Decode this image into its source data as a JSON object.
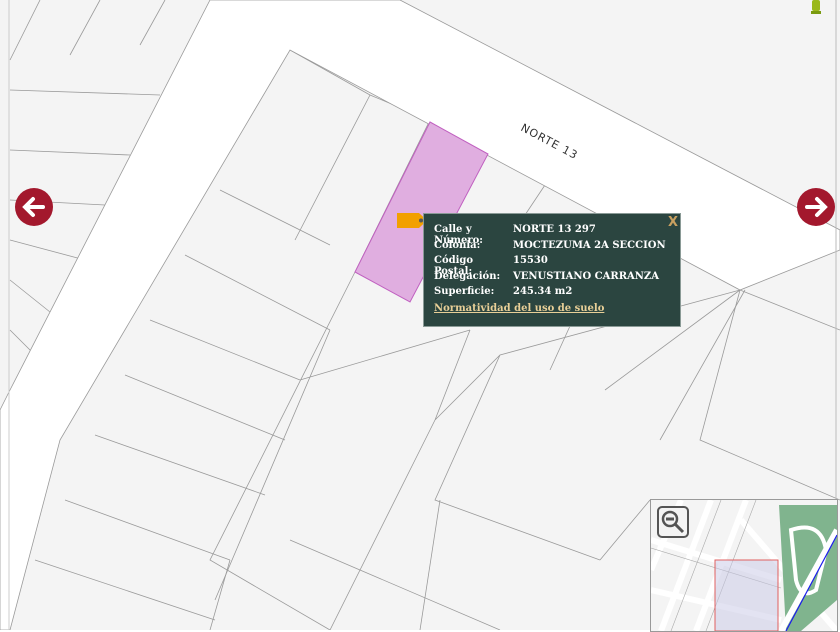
{
  "map": {
    "street_label": "NORTE 13",
    "parcel_highlight_color": "#e0aee0",
    "background": "#f4f4f4"
  },
  "nav": {
    "prev_icon": "arrow-left-icon",
    "next_icon": "arrow-right-icon",
    "color": "#a3182d"
  },
  "popup": {
    "close_label": "X",
    "rows": [
      {
        "label": "Calle y Número:",
        "value": "NORTE 13 297"
      },
      {
        "label": "Colonia:",
        "value": "MOCTEZUMA 2A SECCION"
      },
      {
        "label": "Código Postal:",
        "value": "15530"
      },
      {
        "label": "Delegación:",
        "value": "VENUSTIANO CARRANZA"
      },
      {
        "label": "Superficie:",
        "value": "245.34 m2"
      }
    ],
    "link": "Normatividad del uso de suelo"
  },
  "minimap": {
    "zoom_icon": "zoom-out-icon"
  }
}
